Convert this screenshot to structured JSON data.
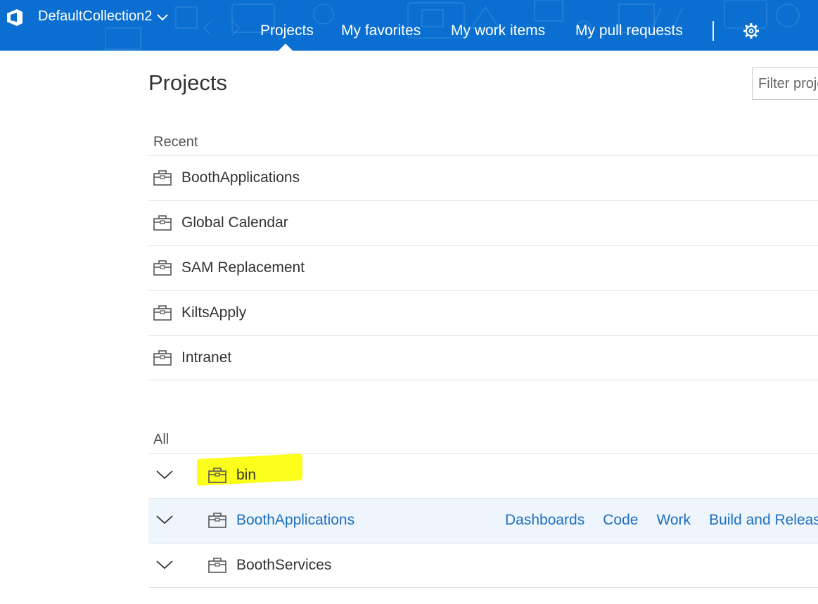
{
  "header": {
    "collection": "DefaultCollection2",
    "nav": [
      "Projects",
      "My favorites",
      "My work items",
      "My pull requests"
    ],
    "active_nav": "Projects",
    "settings_icon": "gear-icon",
    "brand_color": "#0a6fd1"
  },
  "page": {
    "title": "Projects",
    "filter_placeholder": "Filter projects"
  },
  "recent": {
    "label": "Recent",
    "items": [
      "BoothApplications",
      "Global Calendar",
      "SAM Replacement",
      "KiltsApply",
      "Intranet"
    ]
  },
  "all": {
    "label": "All",
    "items": [
      {
        "name": "bin",
        "highlighted": true
      },
      {
        "name": "BoothApplications",
        "selected": true,
        "links": [
          "Dashboards",
          "Code",
          "Work",
          "Build and Release"
        ]
      },
      {
        "name": "BoothServices"
      }
    ]
  },
  "icons": {
    "project": "briefcase-icon",
    "expand": "chevron-down-icon"
  }
}
